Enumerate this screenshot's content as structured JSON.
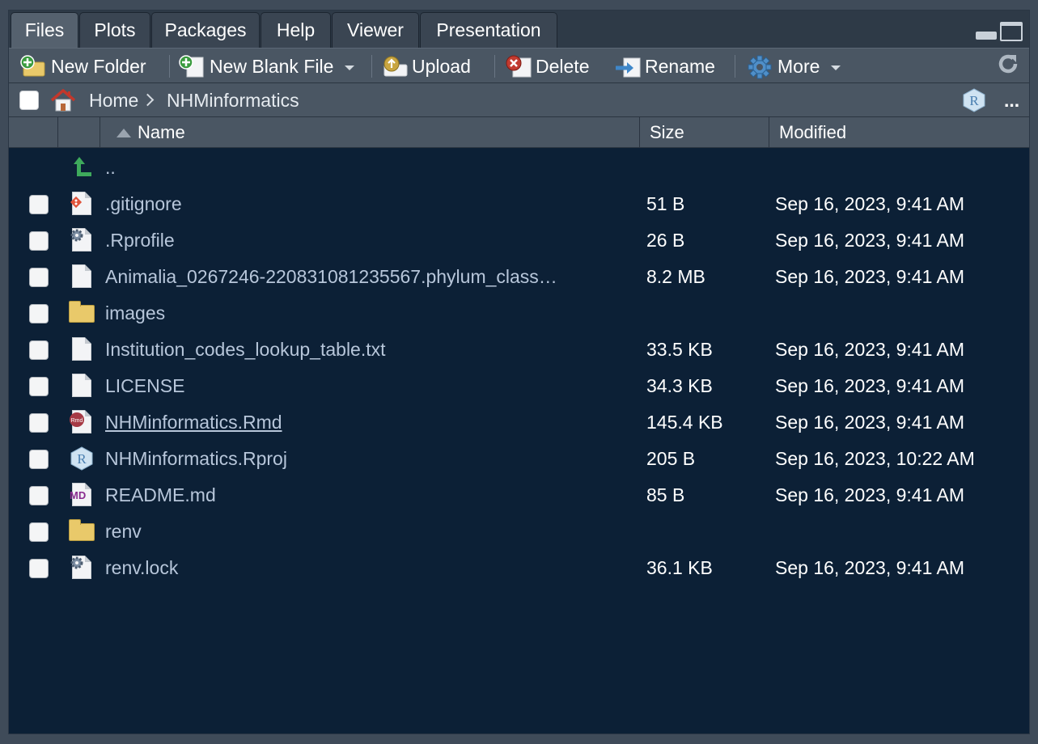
{
  "tabs": [
    {
      "label": "Files",
      "active": true
    },
    {
      "label": "Plots",
      "active": false
    },
    {
      "label": "Packages",
      "active": false
    },
    {
      "label": "Help",
      "active": false
    },
    {
      "label": "Viewer",
      "active": false
    },
    {
      "label": "Presentation",
      "active": false
    }
  ],
  "toolbar": {
    "new_folder": "New Folder",
    "new_blank_file": "New Blank File",
    "upload": "Upload",
    "delete": "Delete",
    "rename": "Rename",
    "more": "More"
  },
  "breadcrumb": {
    "home": "Home",
    "current": "NHMinformatics",
    "overflow": "..."
  },
  "columns": {
    "name": "Name",
    "size": "Size",
    "modified": "Modified"
  },
  "parent_dir": "..",
  "files": [
    {
      "name": ".gitignore",
      "icon": "git-file-icon",
      "size": "51 B",
      "modified": "Sep 16, 2023, 9:41 AM"
    },
    {
      "name": ".Rprofile",
      "icon": "settings-file-icon",
      "size": "26 B",
      "modified": "Sep 16, 2023, 9:41 AM"
    },
    {
      "name": "Animalia_0267246-220831081235567.phylum_class…",
      "icon": "text-file-icon",
      "size": "8.2 MB",
      "modified": "Sep 16, 2023, 9:41 AM"
    },
    {
      "name": "images",
      "icon": "folder-icon",
      "size": "",
      "modified": ""
    },
    {
      "name": "Institution_codes_lookup_table.txt",
      "icon": "text-file-icon",
      "size": "33.5 KB",
      "modified": "Sep 16, 2023, 9:41 AM"
    },
    {
      "name": "LICENSE",
      "icon": "text-file-icon",
      "size": "34.3 KB",
      "modified": "Sep 16, 2023, 9:41 AM"
    },
    {
      "name": "NHMinformatics.Rmd",
      "icon": "rmd-file-icon",
      "size": "145.4 KB",
      "modified": "Sep 16, 2023, 9:41 AM"
    },
    {
      "name": "NHMinformatics.Rproj",
      "icon": "rproj-file-icon",
      "size": "205 B",
      "modified": "Sep 16, 2023, 10:22 AM"
    },
    {
      "name": "README.md",
      "icon": "markdown-file-icon",
      "size": "85 B",
      "modified": "Sep 16, 2023, 9:41 AM"
    },
    {
      "name": "renv",
      "icon": "folder-icon",
      "size": "",
      "modified": ""
    },
    {
      "name": "renv.lock",
      "icon": "settings-file-icon",
      "size": "36.1 KB",
      "modified": "Sep 16, 2023, 9:41 AM"
    }
  ],
  "colors": {
    "pane_bg": "#0c2036",
    "toolbar_bg": "#4a5663",
    "link_text": "#b7c6da"
  }
}
